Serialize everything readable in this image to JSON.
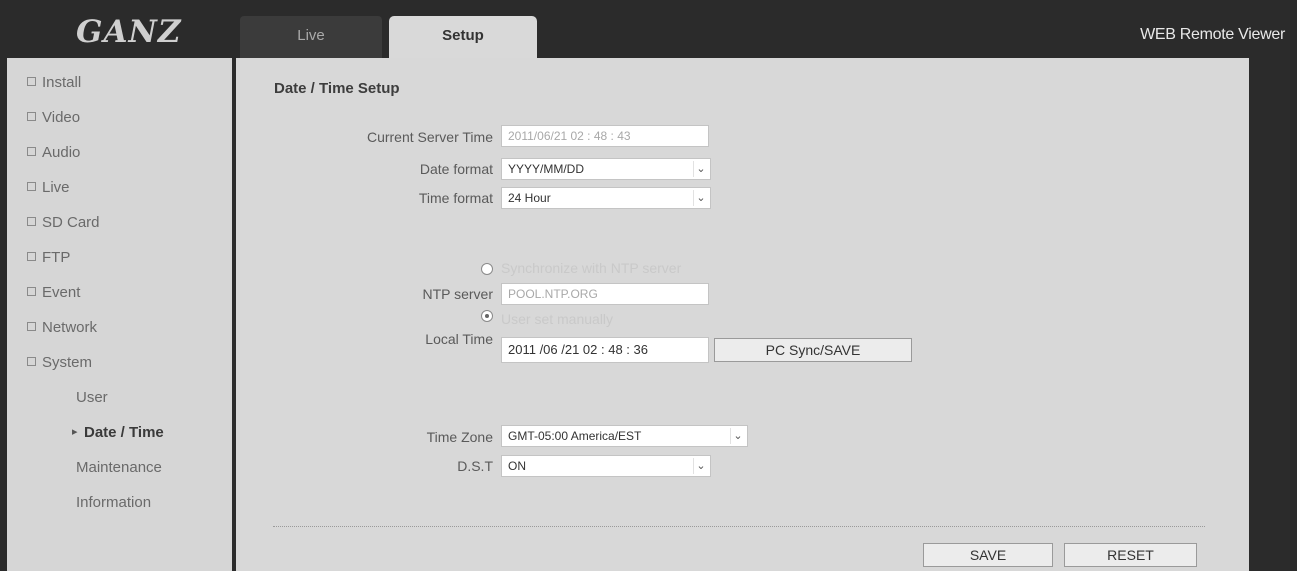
{
  "header": {
    "logo": "GANZ",
    "tabs": [
      {
        "label": "Live"
      },
      {
        "label": "Setup"
      }
    ],
    "viewer_title": "WEB Remote Viewer"
  },
  "sidebar": {
    "items": [
      {
        "label": "Install"
      },
      {
        "label": "Video"
      },
      {
        "label": "Audio"
      },
      {
        "label": "Live"
      },
      {
        "label": "SD Card"
      },
      {
        "label": "FTP"
      },
      {
        "label": "Event"
      },
      {
        "label": "Network"
      },
      {
        "label": "System"
      }
    ],
    "sub_items": [
      {
        "label": "User"
      },
      {
        "label": "Date / Time"
      },
      {
        "label": "Maintenance"
      },
      {
        "label": "Information"
      }
    ]
  },
  "form": {
    "title": "Date / Time Setup",
    "current_server_time_label": "Current Server Time",
    "current_server_time_value": "2011/06/21  02 : 48 : 43",
    "date_format_label": "Date format",
    "date_format_value": "YYYY/MM/DD",
    "time_format_label": "Time format",
    "time_format_value": "24 Hour",
    "ntp_sync_label": "Synchronize with NTP server",
    "ntp_server_label": "NTP server",
    "ntp_server_value": "POOL.NTP.ORG",
    "manual_label": "User set manually",
    "local_time_label": "Local Time",
    "local_time_value": "2011  /06  /21   02  : 48  : 36",
    "pc_sync_button": "PC Sync/SAVE",
    "time_zone_label": "Time Zone",
    "time_zone_value": "GMT-05:00 America/EST",
    "dst_label": "D.S.T",
    "dst_value": "ON",
    "save_button": "SAVE",
    "reset_button": "RESET"
  }
}
